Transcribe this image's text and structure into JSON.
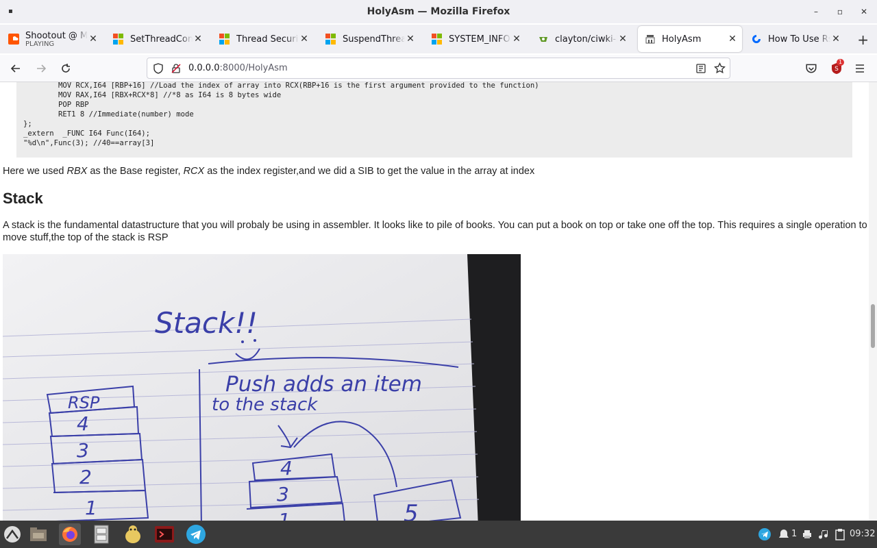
{
  "window": {
    "title": "HolyAsm — Mozilla Firefox"
  },
  "tabs": [
    {
      "label": "Shootout @ My b",
      "sublabel": "PLAYING"
    },
    {
      "label": "SetThreadConte"
    },
    {
      "label": "Thread Security"
    },
    {
      "label": "SuspendThread"
    },
    {
      "label": "SYSTEM_INFO (s"
    },
    {
      "label": "clayton/ciwki-RE"
    },
    {
      "label": "HolyAsm"
    },
    {
      "label": "How To Use Rsyn"
    }
  ],
  "urlbar": {
    "host": "0.0.0.0",
    "rest": ":8000/HolyAsm"
  },
  "notifications": {
    "badge": "1"
  },
  "code": {
    "lines": [
      "        MOV RCX,I64 [RBP+16] //Load the index of array into RCX(RBP+16 is the first argument provided to the function)",
      "        MOV RAX,I64 [RBX+RCX*8] //*8 as I64 is 8 bytes wide",
      "        POP RBP",
      "        RET1 8 //Immediate(number) mode",
      "};",
      "_extern  _FUNC I64 Func(I64);",
      "\"%d\\n\",Func(3); //40==array[3]"
    ]
  },
  "article": {
    "p1_a": "Here we used ",
    "p1_rbx": "RBX",
    "p1_b": " as the Base register, ",
    "p1_rcx": "RCX",
    "p1_c": " as the index register,and we did a SIB to get the value in the array at index",
    "heading": "Stack",
    "p2_line1": "A stack is the fundamental datastructure that you will probaly be using in assembler. It looks like to pile of books. You can put a book on top or take one off the top. This requires a single operation to",
    "p2_line2": "move stuff,the top of the stack is RSP"
  },
  "photo": {
    "title": "Stack!!",
    "caption_line1": "Push adds an item",
    "caption_line2": "to the stack",
    "stack_label": "RSP",
    "stack_items": [
      "4",
      "3",
      "2",
      "1"
    ],
    "pile_items": [
      "4",
      "3",
      "1"
    ],
    "pushed_item": "5"
  },
  "taskbar": {
    "tray_count": "1",
    "time": "09:32"
  },
  "colors": {
    "ink": "#3a3fa8",
    "firefox_orange": "#ff7139",
    "ms_red": "#f25022",
    "ms_green": "#7fba00",
    "ms_blue": "#00a4ef",
    "ms_yellow": "#ffb900"
  }
}
